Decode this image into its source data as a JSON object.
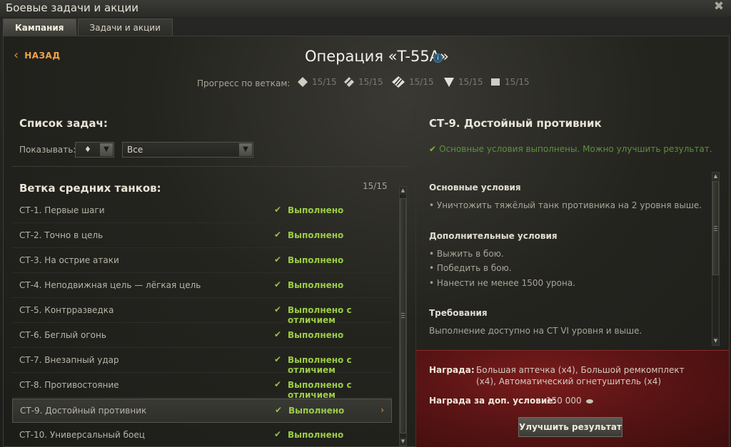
{
  "window": {
    "title": "Боевые задачи и акции",
    "close_glyph": "✖"
  },
  "tabs": [
    {
      "label": "Кампания",
      "active": true
    },
    {
      "label": "Задачи и акции",
      "active": false
    }
  ],
  "header": {
    "back_label": "НАЗАД",
    "operation_title": "Операция «T-55A»",
    "info_glyph": "i",
    "progress_label": "Прогресс по веткам:",
    "branches": [
      {
        "icon": "light-tank-icon",
        "value": "15/15"
      },
      {
        "icon": "medium-tank-icon",
        "value": "15/15"
      },
      {
        "icon": "heavy-tank-icon",
        "value": "15/15"
      },
      {
        "icon": "tank-destroyer-icon",
        "value": "15/15"
      },
      {
        "icon": "spg-icon",
        "value": "15/15"
      }
    ]
  },
  "task_list": {
    "title": "Список задач:",
    "filter_label": "Показывать:",
    "filter_type_value": "♦",
    "filter_value": "Все",
    "branch_title": "Ветка средних танков:",
    "branch_count": "15/15",
    "tasks": [
      {
        "name": "СТ-1. Первые шаги",
        "status": "Выполнено"
      },
      {
        "name": "СТ-2. Точно в цель",
        "status": "Выполнено"
      },
      {
        "name": "СТ-3. На острие атаки",
        "status": "Выполнено"
      },
      {
        "name": "СТ-4. Неподвижная цель — лёгкая цель",
        "status": "Выполнено"
      },
      {
        "name": "СТ-5. Контрразведка",
        "status": "Выполнено с отличием"
      },
      {
        "name": "СТ-6. Беглый огонь",
        "status": "Выполнено"
      },
      {
        "name": "СТ-7. Внезапный удар",
        "status": "Выполнено с отличием"
      },
      {
        "name": "СТ-8. Противостояние",
        "status": "Выполнено с отличием"
      },
      {
        "name": "СТ-9. Достойный противник",
        "status": "Выполнено",
        "selected": true
      },
      {
        "name": "СТ-10. Универсальный боец",
        "status": "Выполнено"
      }
    ],
    "check_glyph": "✔",
    "chevron_glyph": "›"
  },
  "detail": {
    "title": "СТ-9. Достойный противник",
    "status": "Основные условия выполнены. Можно улучшить результат.",
    "main_conditions_heading": "Основные условия",
    "main_conditions": [
      "• Уничтожить тяжёлый танк противника на 2 уровня выше."
    ],
    "extra_conditions_heading": "Дополнительные условия",
    "extra_conditions": [
      "• Выжить в бою.",
      "• Победить в бою.",
      "• Нанести не менее 1500 урона."
    ],
    "requirements_heading": "Требования",
    "requirements_text": "Выполнение доступно на СТ VI уровня и выше.",
    "reward_label": "Награда:",
    "reward_line1": "Большая аптечка (x4), Большой ремкомплект",
    "reward_line2": "(x4), Автоматический огнетушитель (x4)",
    "extra_reward_label": "Награда за доп. условие:",
    "extra_reward_value": "150 000",
    "improve_button": "Улучшить результат"
  },
  "colors": {
    "accent_orange": "#f0a347",
    "status_green": "#9acc45",
    "reward_red": "#5a1414"
  }
}
